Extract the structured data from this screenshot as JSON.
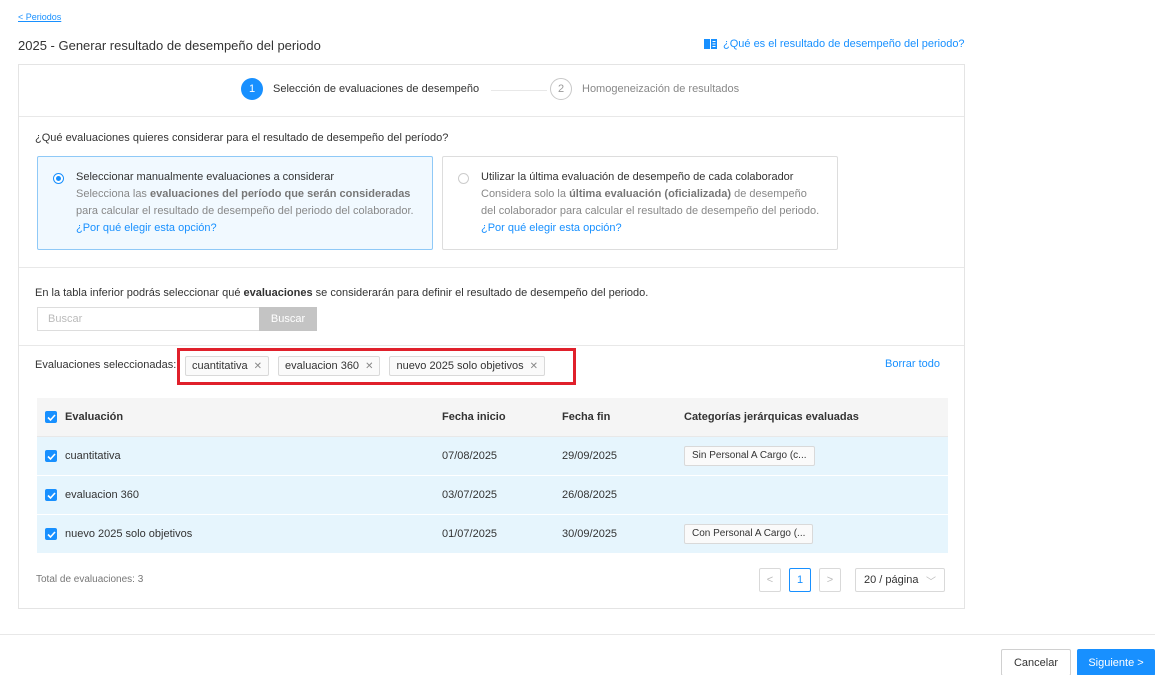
{
  "nav": {
    "back_label": "< Periodos"
  },
  "header": {
    "title": "2025 - Generar resultado de desempeño del periodo",
    "help_link": "¿Qué es el resultado de desempeño del periodo?"
  },
  "steps": [
    {
      "number": "1",
      "label": "Selección de evaluaciones de desempeño",
      "active": true
    },
    {
      "number": "2",
      "label": "Homogeneización de resultados",
      "active": false
    }
  ],
  "question": "¿Qué evaluaciones quieres considerar para el resultado de desempeño del período?",
  "options": [
    {
      "title": "Seleccionar manualmente evaluaciones a considerar",
      "desc_a": "Selecciona las ",
      "desc_b": "evaluaciones del período que serán consideradas",
      "desc_c": " para calcular el resultado de desempeño del periodo del colaborador.",
      "link": "¿Por qué elegir esta opción?",
      "selected": true
    },
    {
      "title": "Utilizar la última evaluación de desempeño de cada colaborador",
      "desc_a": "Considera solo la ",
      "desc_b": "última evaluación (oficializada)",
      "desc_c": " de desempeño del colaborador para calcular el resultado de desempeño del periodo.",
      "link": "¿Por qué elegir esta opción?",
      "selected": false
    }
  ],
  "info": {
    "text_a": "En la tabla inferior podrás seleccionar qué ",
    "text_b": "evaluaciones",
    "text_c": " se considerarán para definir el resultado de desempeño del periodo."
  },
  "search": {
    "placeholder": "Buscar",
    "button_label": "Buscar"
  },
  "selected": {
    "label": "Evaluaciones seleccionadas:",
    "tags": [
      "cuantitativa",
      "evaluacion 360",
      "nuevo 2025 solo objetivos"
    ],
    "clear_all": "Borrar todo"
  },
  "table": {
    "headers": {
      "name": "Evaluación",
      "start": "Fecha inicio",
      "end": "Fecha fin",
      "categories": "Categorías jerárquicas evaluadas"
    },
    "rows": [
      {
        "name": "cuantitativa",
        "start": "07/08/2025",
        "end": "29/09/2025",
        "category": "Sin Personal A Cargo (c..."
      },
      {
        "name": "evaluacion 360",
        "start": "03/07/2025",
        "end": "26/08/2025",
        "category": ""
      },
      {
        "name": "nuevo 2025 solo objetivos",
        "start": "01/07/2025",
        "end": "30/09/2025",
        "category": "Con Personal A Cargo (..."
      }
    ]
  },
  "pagination": {
    "total_label": "Total de evaluaciones: 3",
    "prev": "<",
    "current_page": "1",
    "next": ">",
    "page_size": "20 / página"
  },
  "footer": {
    "cancel_label": "Cancelar",
    "next_label": "Siguiente >"
  },
  "colors": {
    "primary": "#1890ff",
    "highlight_border": "#e0202b",
    "selected_row": "#e6f5fd"
  }
}
